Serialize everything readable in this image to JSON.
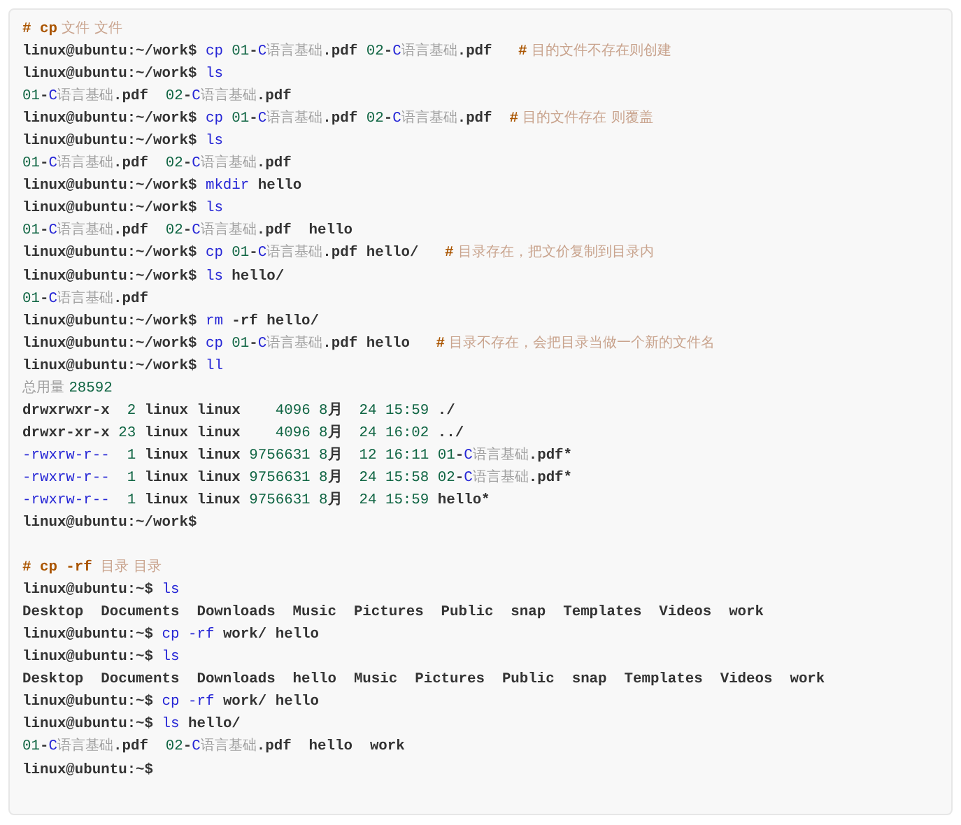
{
  "code_block": {
    "sections": [
      {
        "lines": [
          [
            {
              "kind": "comment",
              "text": "# cp"
            },
            {
              "kind": "comment_cjk",
              "text": " 文件 文件"
            }
          ],
          [
            {
              "kind": "plain",
              "text": "linux@ubuntu:~/work$ "
            },
            {
              "kind": "keyword",
              "text": "cp"
            },
            {
              "kind": "number",
              "text": " 01"
            },
            {
              "kind": "plain",
              "text": "-"
            },
            {
              "kind": "keyword",
              "text": "C"
            },
            {
              "kind": "cjk",
              "text": "语言基础"
            },
            {
              "kind": "plain",
              "text": ".pdf "
            },
            {
              "kind": "number",
              "text": "02"
            },
            {
              "kind": "plain",
              "text": "-"
            },
            {
              "kind": "keyword",
              "text": "C"
            },
            {
              "kind": "cjk",
              "text": "语言基础"
            },
            {
              "kind": "plain",
              "text": ".pdf   "
            },
            {
              "kind": "comment",
              "text": "#"
            },
            {
              "kind": "comment_cjk",
              "text": " 目的文件不存在则创建"
            }
          ],
          [
            {
              "kind": "plain",
              "text": "linux@ubuntu:~/work$ "
            },
            {
              "kind": "keyword",
              "text": "ls"
            }
          ],
          [
            {
              "kind": "number",
              "text": "01"
            },
            {
              "kind": "plain",
              "text": "-"
            },
            {
              "kind": "keyword",
              "text": "C"
            },
            {
              "kind": "cjk",
              "text": "语言基础"
            },
            {
              "kind": "plain",
              "text": ".pdf  "
            },
            {
              "kind": "number",
              "text": "02"
            },
            {
              "kind": "plain",
              "text": "-"
            },
            {
              "kind": "keyword",
              "text": "C"
            },
            {
              "kind": "cjk",
              "text": "语言基础"
            },
            {
              "kind": "plain",
              "text": ".pdf"
            }
          ],
          [
            {
              "kind": "plain",
              "text": "linux@ubuntu:~/work$ "
            },
            {
              "kind": "keyword",
              "text": "cp"
            },
            {
              "kind": "number",
              "text": " 01"
            },
            {
              "kind": "plain",
              "text": "-"
            },
            {
              "kind": "keyword",
              "text": "C"
            },
            {
              "kind": "cjk",
              "text": "语言基础"
            },
            {
              "kind": "plain",
              "text": ".pdf "
            },
            {
              "kind": "number",
              "text": "02"
            },
            {
              "kind": "plain",
              "text": "-"
            },
            {
              "kind": "keyword",
              "text": "C"
            },
            {
              "kind": "cjk",
              "text": "语言基础"
            },
            {
              "kind": "plain",
              "text": ".pdf  "
            },
            {
              "kind": "comment",
              "text": "#"
            },
            {
              "kind": "comment_cjk",
              "text": " 目的文件存在 则覆盖"
            }
          ],
          [
            {
              "kind": "plain",
              "text": "linux@ubuntu:~/work$ "
            },
            {
              "kind": "keyword",
              "text": "ls"
            }
          ],
          [
            {
              "kind": "number",
              "text": "01"
            },
            {
              "kind": "plain",
              "text": "-"
            },
            {
              "kind": "keyword",
              "text": "C"
            },
            {
              "kind": "cjk",
              "text": "语言基础"
            },
            {
              "kind": "plain",
              "text": ".pdf  "
            },
            {
              "kind": "number",
              "text": "02"
            },
            {
              "kind": "plain",
              "text": "-"
            },
            {
              "kind": "keyword",
              "text": "C"
            },
            {
              "kind": "cjk",
              "text": "语言基础"
            },
            {
              "kind": "plain",
              "text": ".pdf"
            }
          ],
          [
            {
              "kind": "plain",
              "text": "linux@ubuntu:~/work$ "
            },
            {
              "kind": "keyword",
              "text": "mkdir"
            },
            {
              "kind": "plain",
              "text": " hello"
            }
          ],
          [
            {
              "kind": "plain",
              "text": "linux@ubuntu:~/work$ "
            },
            {
              "kind": "keyword",
              "text": "ls"
            }
          ],
          [
            {
              "kind": "number",
              "text": "01"
            },
            {
              "kind": "plain",
              "text": "-"
            },
            {
              "kind": "keyword",
              "text": "C"
            },
            {
              "kind": "cjk",
              "text": "语言基础"
            },
            {
              "kind": "plain",
              "text": ".pdf  "
            },
            {
              "kind": "number",
              "text": "02"
            },
            {
              "kind": "plain",
              "text": "-"
            },
            {
              "kind": "keyword",
              "text": "C"
            },
            {
              "kind": "cjk",
              "text": "语言基础"
            },
            {
              "kind": "plain",
              "text": ".pdf  hello"
            }
          ],
          [
            {
              "kind": "plain",
              "text": "linux@ubuntu:~/work$ "
            },
            {
              "kind": "keyword",
              "text": "cp"
            },
            {
              "kind": "number",
              "text": " 01"
            },
            {
              "kind": "plain",
              "text": "-"
            },
            {
              "kind": "keyword",
              "text": "C"
            },
            {
              "kind": "cjk",
              "text": "语言基础"
            },
            {
              "kind": "plain",
              "text": ".pdf hello/   "
            },
            {
              "kind": "comment",
              "text": "#"
            },
            {
              "kind": "comment_cjk",
              "text": " 目录存在，把文价复制到目录内"
            }
          ],
          [
            {
              "kind": "plain",
              "text": "linux@ubuntu:~/work$ "
            },
            {
              "kind": "keyword",
              "text": "ls"
            },
            {
              "kind": "plain",
              "text": " hello/"
            }
          ],
          [
            {
              "kind": "number",
              "text": "01"
            },
            {
              "kind": "plain",
              "text": "-"
            },
            {
              "kind": "keyword",
              "text": "C"
            },
            {
              "kind": "cjk",
              "text": "语言基础"
            },
            {
              "kind": "plain",
              "text": ".pdf"
            }
          ],
          [
            {
              "kind": "plain",
              "text": "linux@ubuntu:~/work$ "
            },
            {
              "kind": "keyword",
              "text": "rm"
            },
            {
              "kind": "plain",
              "text": " -rf hello/"
            }
          ],
          [
            {
              "kind": "plain",
              "text": "linux@ubuntu:~/work$ "
            },
            {
              "kind": "keyword",
              "text": "cp"
            },
            {
              "kind": "number",
              "text": " 01"
            },
            {
              "kind": "plain",
              "text": "-"
            },
            {
              "kind": "keyword",
              "text": "C"
            },
            {
              "kind": "cjk",
              "text": "语言基础"
            },
            {
              "kind": "plain",
              "text": ".pdf hello   "
            },
            {
              "kind": "comment",
              "text": "#"
            },
            {
              "kind": "comment_cjk",
              "text": " 目录不存在，会把目录当做一个新的文件名"
            }
          ],
          [
            {
              "kind": "plain",
              "text": "linux@ubuntu:~/work$ "
            },
            {
              "kind": "keyword",
              "text": "ll"
            }
          ],
          [
            {
              "kind": "cjk",
              "text": "总用量 "
            },
            {
              "kind": "number",
              "text": "28592"
            }
          ],
          [
            {
              "kind": "plain",
              "text": "drwxrwxr-x  "
            },
            {
              "kind": "number",
              "text": "2"
            },
            {
              "kind": "plain",
              "text": " linux linux    "
            },
            {
              "kind": "number",
              "text": "4096 8"
            },
            {
              "kind": "plain",
              "text": "月  "
            },
            {
              "kind": "number",
              "text": "24 15:59"
            },
            {
              "kind": "plain",
              "text": " ./"
            }
          ],
          [
            {
              "kind": "plain",
              "text": "drwxr-xr-x "
            },
            {
              "kind": "number",
              "text": "23"
            },
            {
              "kind": "plain",
              "text": " linux linux    "
            },
            {
              "kind": "number",
              "text": "4096 8"
            },
            {
              "kind": "plain",
              "text": "月  "
            },
            {
              "kind": "number",
              "text": "24 16:02"
            },
            {
              "kind": "plain",
              "text": " ../"
            }
          ],
          [
            {
              "kind": "keyword",
              "text": "-rwxrw-r--"
            },
            {
              "kind": "number",
              "text": "  1"
            },
            {
              "kind": "plain",
              "text": " linux linux "
            },
            {
              "kind": "number",
              "text": "9756631 8"
            },
            {
              "kind": "plain",
              "text": "月  "
            },
            {
              "kind": "number",
              "text": "12 16:11 01"
            },
            {
              "kind": "plain",
              "text": "-"
            },
            {
              "kind": "keyword",
              "text": "C"
            },
            {
              "kind": "cjk",
              "text": "语言基础"
            },
            {
              "kind": "plain",
              "text": ".pdf*"
            }
          ],
          [
            {
              "kind": "keyword",
              "text": "-rwxrw-r--"
            },
            {
              "kind": "number",
              "text": "  1"
            },
            {
              "kind": "plain",
              "text": " linux linux "
            },
            {
              "kind": "number",
              "text": "9756631 8"
            },
            {
              "kind": "plain",
              "text": "月  "
            },
            {
              "kind": "number",
              "text": "24 15:58 02"
            },
            {
              "kind": "plain",
              "text": "-"
            },
            {
              "kind": "keyword",
              "text": "C"
            },
            {
              "kind": "cjk",
              "text": "语言基础"
            },
            {
              "kind": "plain",
              "text": ".pdf*"
            }
          ],
          [
            {
              "kind": "keyword",
              "text": "-rwxrw-r--"
            },
            {
              "kind": "number",
              "text": "  1"
            },
            {
              "kind": "plain",
              "text": " linux linux "
            },
            {
              "kind": "number",
              "text": "9756631 8"
            },
            {
              "kind": "plain",
              "text": "月  "
            },
            {
              "kind": "number",
              "text": "24 15:59"
            },
            {
              "kind": "plain",
              "text": " hello*"
            }
          ],
          [
            {
              "kind": "plain",
              "text": "linux@ubuntu:~/work$"
            }
          ]
        ]
      },
      {
        "lines": [
          [
            {
              "kind": "comment",
              "text": "# cp -rf"
            },
            {
              "kind": "comment_cjk",
              "text": "  目录 目录"
            }
          ],
          [
            {
              "kind": "plain",
              "text": "linux@ubuntu:~$ "
            },
            {
              "kind": "keyword",
              "text": "ls"
            }
          ],
          [
            {
              "kind": "plain",
              "text": "Desktop  Documents  Downloads  Music  Pictures  Public  snap  Templates  Videos  work"
            }
          ],
          [
            {
              "kind": "plain",
              "text": "linux@ubuntu:~$ "
            },
            {
              "kind": "keyword",
              "text": "cp -rf"
            },
            {
              "kind": "plain",
              "text": " work/ hello"
            }
          ],
          [
            {
              "kind": "plain",
              "text": "linux@ubuntu:~$ "
            },
            {
              "kind": "keyword",
              "text": "ls"
            }
          ],
          [
            {
              "kind": "plain",
              "text": "Desktop  Documents  Downloads  hello  Music  Pictures  Public  snap  Templates  Videos  work"
            }
          ],
          [
            {
              "kind": "plain",
              "text": "linux@ubuntu:~$ "
            },
            {
              "kind": "keyword",
              "text": "cp -rf"
            },
            {
              "kind": "plain",
              "text": " work/ hello"
            }
          ],
          [
            {
              "kind": "plain",
              "text": "linux@ubuntu:~$ "
            },
            {
              "kind": "keyword",
              "text": "ls"
            },
            {
              "kind": "plain",
              "text": " hello/"
            }
          ],
          [
            {
              "kind": "number",
              "text": "01"
            },
            {
              "kind": "plain",
              "text": "-"
            },
            {
              "kind": "keyword",
              "text": "C"
            },
            {
              "kind": "cjk",
              "text": "语言基础"
            },
            {
              "kind": "plain",
              "text": ".pdf  "
            },
            {
              "kind": "number",
              "text": "02"
            },
            {
              "kind": "plain",
              "text": "-"
            },
            {
              "kind": "keyword",
              "text": "C"
            },
            {
              "kind": "cjk",
              "text": "语言基础"
            },
            {
              "kind": "plain",
              "text": ".pdf  hello  work"
            }
          ],
          [
            {
              "kind": "plain",
              "text": "linux@ubuntu:~$"
            }
          ]
        ]
      }
    ]
  }
}
